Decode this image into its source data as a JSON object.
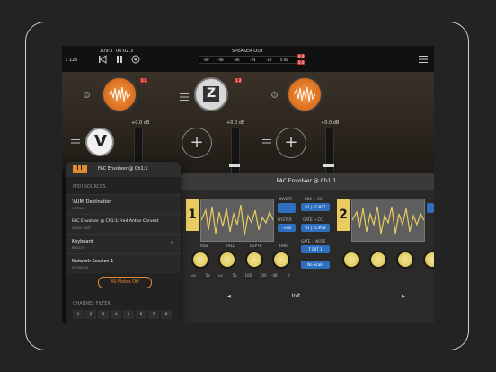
{
  "topbar": {
    "tempo": "♩ 125",
    "position": "109:3",
    "time": "06:02.3",
    "output_label": "SPEAKER OUT",
    "meter_ticks": [
      "-60",
      "-48",
      "-36",
      "-24",
      "-12",
      "0 dB"
    ],
    "clip_left": "0.0",
    "clip_right": "0.0"
  },
  "mixer": {
    "node_badges": [
      "1 2",
      "1 2",
      ""
    ],
    "node_gains": [
      "+0.0 dB",
      "+0.0 dB",
      "+0.0 dB"
    ],
    "vol_readouts": [
      "+0.0 dB",
      "+0.0 dB"
    ],
    "selected_node_logo": "V",
    "tremor_logo": "Z"
  },
  "panel": {
    "title": "FAC Envolver @ Ch1:1",
    "section1_number": "1",
    "section2_number": "2",
    "side_labels": [
      "INVERT",
      "ENV → CC",
      "HYSTER",
      "GATE → CC",
      "GATE → NOTE"
    ],
    "side_buttons": [
      "-∞dB",
      "01 | CC#07",
      "01 | CC#08",
      "T EXT 1",
      "No Scale"
    ],
    "knob_labels": [
      "RISE",
      "FALL",
      "DEPTH",
      "THRS"
    ],
    "knob_scale": [
      "-∞s",
      "5s",
      "-∞s",
      "5s",
      "-100",
      "100",
      "-48",
      "0"
    ],
    "preset_name": "... Init ...",
    "prev_arrow": "◀",
    "next_arrow": "▶"
  },
  "popup": {
    "title": "FAC Envolver @ Ch1:1",
    "section_label": "MIDI SOURCES",
    "sources": [
      {
        "name": "'AUM' Destination",
        "sub": "VIRTUAL",
        "checked": false
      },
      {
        "name": "FAC Envolver @ Ch1:1:Fred Anton Corvest",
        "sub": "AUDIO UNIT",
        "checked": false
      },
      {
        "name": "Keyboard",
        "sub": "BUILT-IN",
        "checked": true
      },
      {
        "name": "Network Session 1",
        "sub": "NETWORK",
        "checked": false
      }
    ],
    "all_notes_off": "All Notes Off",
    "channel_filter_label": "CHANNEL FILTER",
    "channels": [
      "1",
      "2",
      "3",
      "4",
      "5",
      "6",
      "7",
      "8"
    ],
    "checkmark": "✓"
  },
  "colors": {
    "accent_orange": "#e08a2e",
    "accent_yellow": "#e8cc62",
    "accent_blue": "#2e6fbf",
    "clip_red": "#c62e2e"
  }
}
